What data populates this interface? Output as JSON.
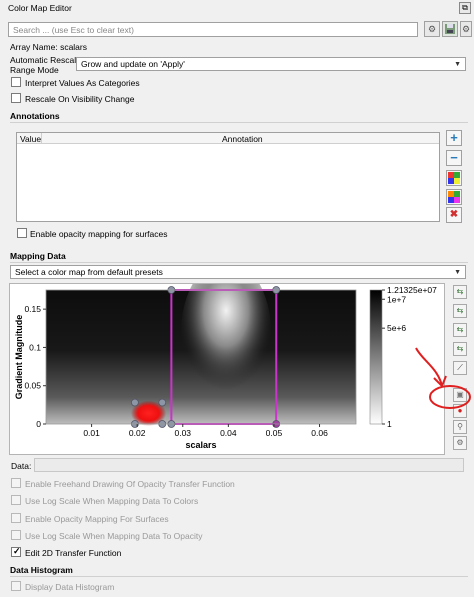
{
  "window": {
    "title": "Color Map Editor",
    "float_glyph": "⧉"
  },
  "search": {
    "placeholder": "Search ... (use Esc to clear text)"
  },
  "array_name": "Array Name: scalars",
  "rescale": {
    "label_line1": "Automatic Rescale",
    "label_line2": "Range Mode",
    "value": "Grow and update on 'Apply'"
  },
  "checkboxes_top": [
    {
      "label": "Interpret Values As Categories",
      "checked": false
    },
    {
      "label": "Rescale On Visibility Change",
      "checked": false
    }
  ],
  "annotations": {
    "heading": "Annotations",
    "col_value": "Value",
    "col_annotation": "Annotation",
    "opacity_label": "Enable opacity mapping for surfaces"
  },
  "mapping": {
    "heading": "Mapping Data",
    "preset_placeholder": "Select a color map from default presets"
  },
  "chart_data": {
    "type": "heatmap",
    "title": "",
    "xlabel": "scalars",
    "ylabel": "Gradient Magnitude",
    "xlim": [
      0.0,
      0.068
    ],
    "ylim": [
      0,
      0.175
    ],
    "x_ticks": [
      "0.01",
      "0.02",
      "0.03",
      "0.04",
      "0.05",
      "0.06"
    ],
    "x_tick_values": [
      0.01,
      0.02,
      0.03,
      0.04,
      0.05,
      0.06
    ],
    "y_ticks": [
      "0",
      "0.05",
      "0.1",
      "0.15"
    ],
    "y_tick_values": [
      0,
      0.05,
      0.1,
      0.15
    ],
    "colorbar": {
      "scale": "log",
      "max_label": "1.21325e+07",
      "labels": [
        "1.21325e+07",
        "1e+7",
        "5e+6",
        "1"
      ],
      "label_values": [
        12132500,
        10000000,
        5000000,
        1
      ]
    },
    "transfer_boxes": [
      {
        "name": "magenta-box",
        "x0": 0.0275,
        "x1": 0.0505,
        "y0": 0,
        "y1": 0.175,
        "color": "#cc33cc"
      },
      {
        "name": "red-box",
        "x0": 0.0195,
        "x1": 0.0255,
        "y0": 0,
        "y1": 0.028,
        "color": "#ff0000"
      }
    ]
  },
  "toolbar_right": [
    "rescale-to-data-icon",
    "rescale-custom-icon",
    "rescale-visible-icon",
    "rescale-temporal-icon",
    "invert-icon",
    "choose-box-color-icon",
    "custom-red-icon"
  ],
  "data_label": "Data:",
  "checkboxes_bottom": [
    {
      "label": "Enable Freehand Drawing Of Opacity Transfer Function",
      "checked": false,
      "disabled": true
    },
    {
      "label": "Use Log Scale When Mapping Data To Colors",
      "checked": false,
      "disabled": true
    },
    {
      "label": "Enable Opacity Mapping For Surfaces",
      "checked": false,
      "disabled": true
    },
    {
      "label": "Use Log Scale When Mapping Data To Opacity",
      "checked": false,
      "disabled": true
    },
    {
      "label": "Edit 2D Transfer Function",
      "checked": true,
      "disabled": false
    }
  ],
  "histogram": {
    "heading": "Data Histogram",
    "display_label": "Display Data Histogram"
  },
  "annotation_colors": {
    "accent": "#cc33cc",
    "highlight": "#e02020",
    "plus": "#2a7ab8",
    "delete": "#d03030"
  }
}
